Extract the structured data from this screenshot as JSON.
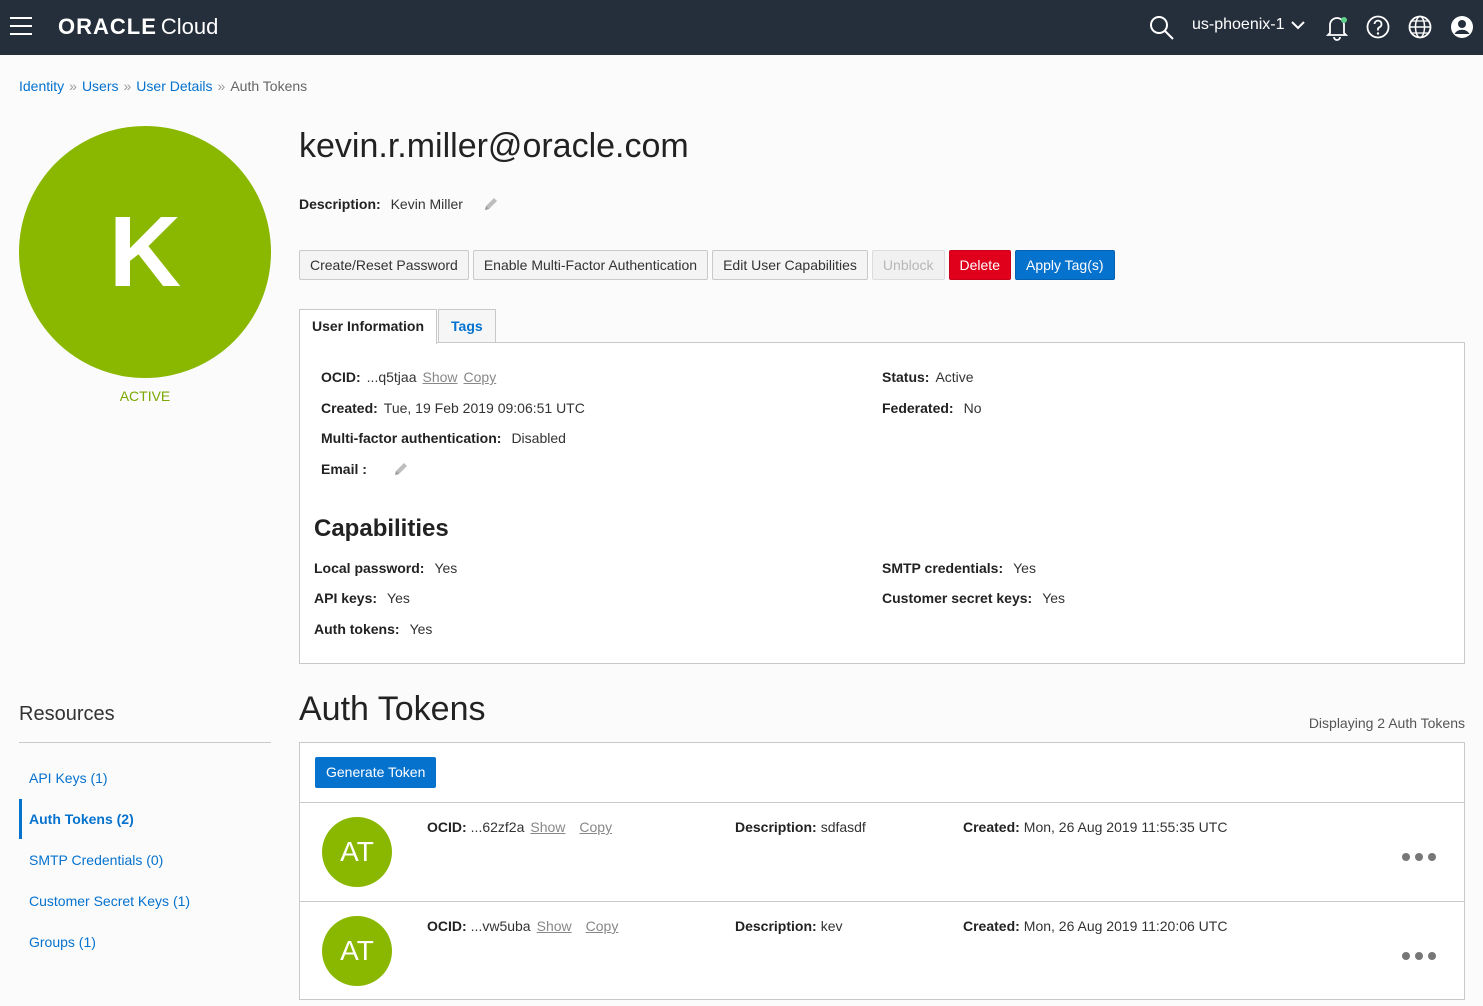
{
  "header": {
    "brand": "ORACLE",
    "product": "Cloud",
    "region": "us-phoenix-1"
  },
  "breadcrumb": {
    "items": [
      "Identity",
      "Users",
      "User Details"
    ],
    "separator": "»",
    "current": "Auth Tokens"
  },
  "avatar": {
    "initial": "K",
    "status": "ACTIVE",
    "color": "#8ab700"
  },
  "user": {
    "email": "kevin.r.miller@oracle.com",
    "description_label": "Description:",
    "description_value": "Kevin Miller"
  },
  "actions": {
    "create_reset_password": "Create/Reset Password",
    "enable_mfa": "Enable Multi-Factor Authentication",
    "edit_capabilities": "Edit User Capabilities",
    "unblock": "Unblock",
    "delete": "Delete",
    "apply_tags": "Apply Tag(s)"
  },
  "tabs": [
    "User Information",
    "Tags"
  ],
  "info": {
    "ocid_label": "OCID:",
    "ocid_value": "...q5tjaa",
    "show": "Show",
    "copy": "Copy",
    "created_label": "Created:",
    "created_value": "Tue, 19 Feb 2019 09:06:51 UTC",
    "mfa_label": "Multi-factor authentication:",
    "mfa_value": "Disabled",
    "email_label": "Email :",
    "status_label": "Status:",
    "status_value": "Active",
    "federated_label": "Federated:",
    "federated_value": "No"
  },
  "capabilities": {
    "title": "Capabilities",
    "local_password_label": "Local password:",
    "local_password_value": "Yes",
    "api_keys_label": "API keys:",
    "api_keys_value": "Yes",
    "auth_tokens_label": "Auth tokens:",
    "auth_tokens_value": "Yes",
    "smtp_label": "SMTP credentials:",
    "smtp_value": "Yes",
    "customer_secret_label": "Customer secret keys:",
    "customer_secret_value": "Yes"
  },
  "resources": {
    "title": "Resources",
    "items": [
      "API Keys (1)",
      "Auth Tokens (2)",
      "SMTP Credentials (0)",
      "Customer Secret Keys (1)",
      "Groups (1)"
    ],
    "active": "Auth Tokens (2)"
  },
  "auth_tokens": {
    "title": "Auth Tokens",
    "count_text": "Displaying 2 Auth Tokens",
    "generate_button": "Generate Token",
    "labels": {
      "ocid": "OCID:",
      "description": "Description:",
      "created": "Created:",
      "show": "Show",
      "copy": "Copy"
    },
    "rows": [
      {
        "avatar": "AT",
        "ocid": "...62zf2a",
        "description": "sdfasdf",
        "created": "Mon, 26 Aug 2019 11:55:35 UTC"
      },
      {
        "avatar": "AT",
        "ocid": "...vw5uba",
        "description": "kev",
        "created": "Mon, 26 Aug 2019 11:20:06 UTC"
      }
    ]
  }
}
